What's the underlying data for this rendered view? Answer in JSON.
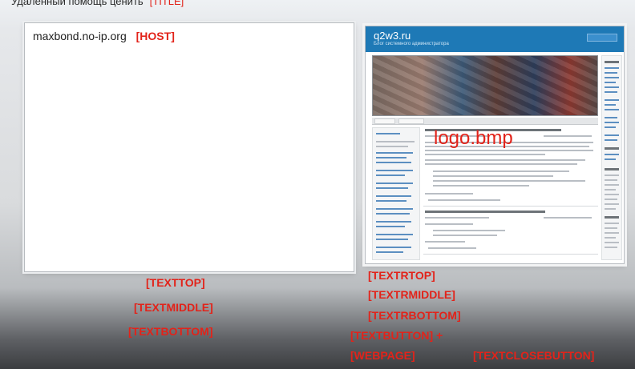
{
  "header": {
    "caption": "Удалённый помощь ценить",
    "caption_tag": "[TITLE]"
  },
  "host_panel": {
    "host_text": "maxbond.no-ip.org",
    "host_tag": "[HOST]"
  },
  "thumbnail": {
    "site_title": "q2w3.ru",
    "site_subtitle": "Блог системного администратора",
    "logo_label": "logo.bmp"
  },
  "left_tags": {
    "texttop": "[TEXTTOP]",
    "textmiddle": "[TEXTMIDDLE]",
    "textbottom": "[TEXTBOTTOM]"
  },
  "right_tags": {
    "textrtop": "[TEXTRTOP]",
    "textrmiddle": "[TEXTRMIDDLE]",
    "textrbottom": "[TEXTRBOTTOM]",
    "textbutton": "[TEXTBUTTON] +",
    "webpage": "[WEBPAGE]",
    "textclosebutton": "[TEXTCLOSEBUTTON]"
  },
  "colors": {
    "tag_red": "#e2231a",
    "site_blue": "#1e79b6"
  }
}
